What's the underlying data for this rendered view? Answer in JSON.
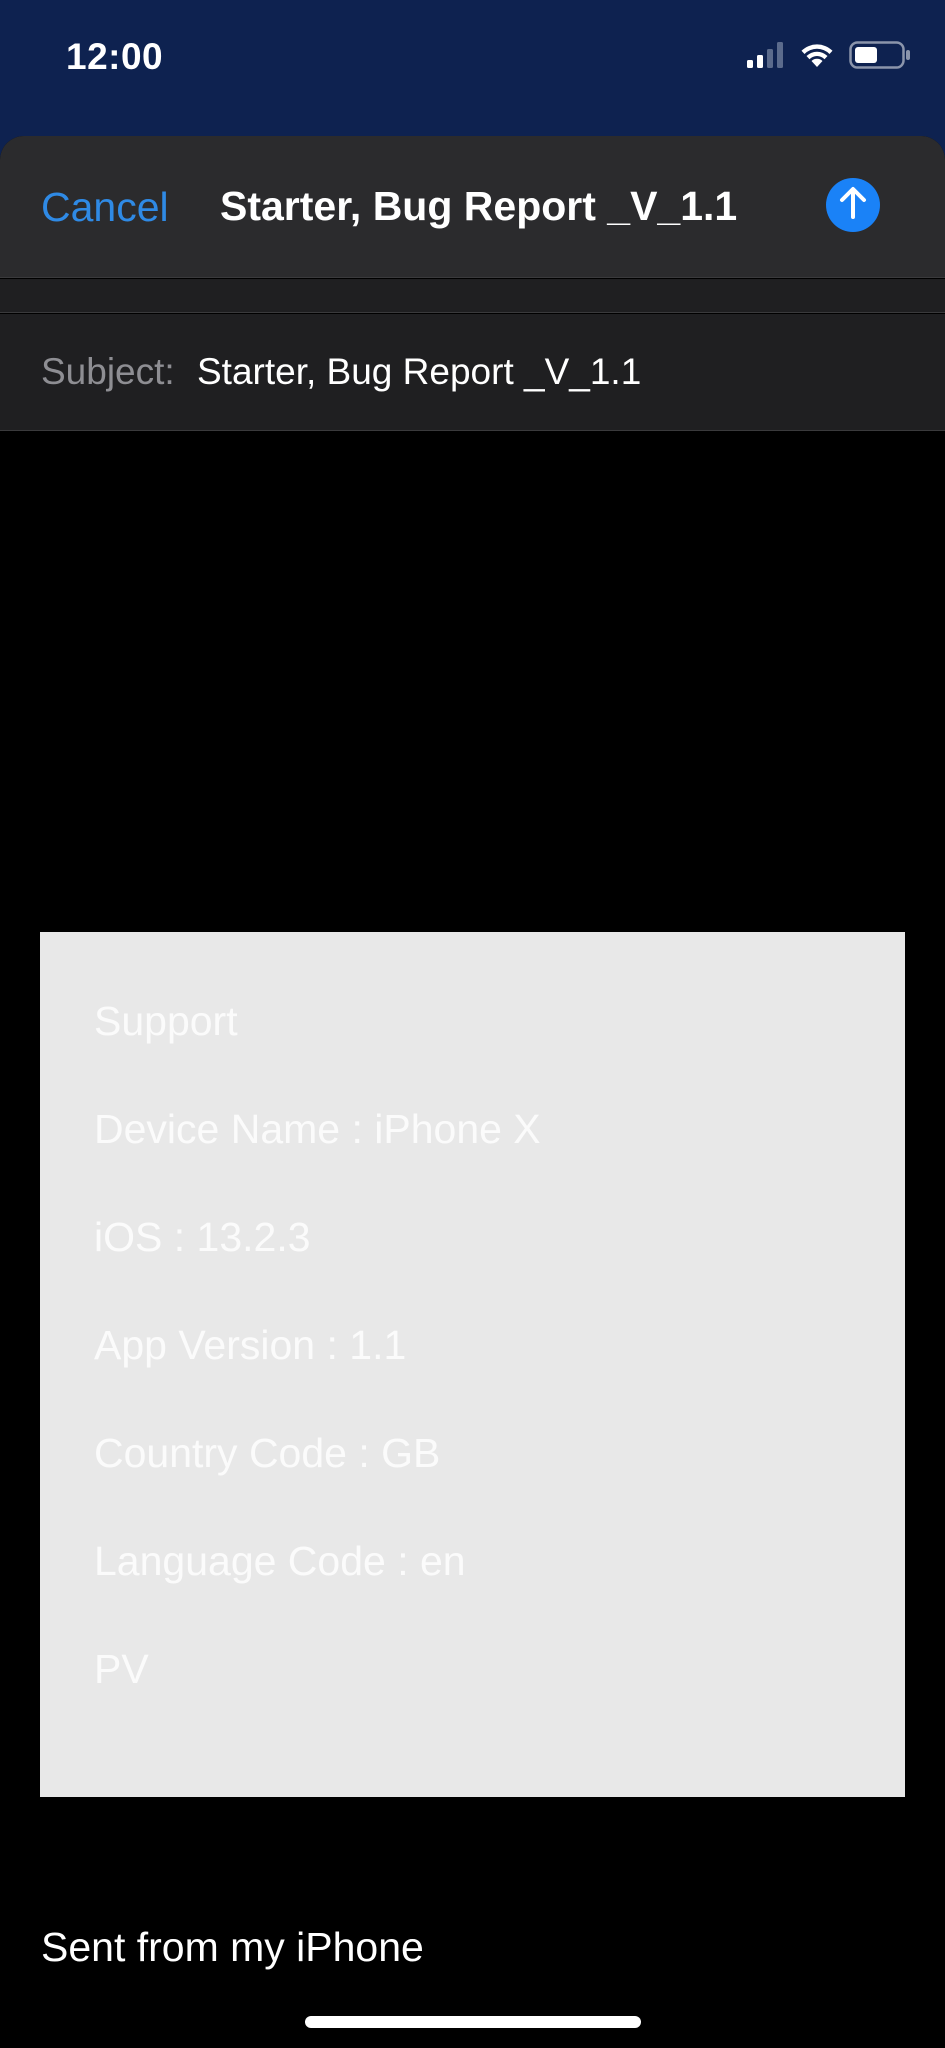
{
  "status_bar": {
    "time": "12:00",
    "icons": [
      "cellular-signal-icon",
      "wifi-icon",
      "battery-icon"
    ]
  },
  "compose": {
    "cancel_label": "Cancel",
    "title": "Starter, Bug Report _V_1.1",
    "send_icon": "arrow-up-icon",
    "subject_label": "Subject:",
    "subject_value": "Starter, Bug Report _V_1.1"
  },
  "body": {
    "info_lines": [
      "Support",
      "Device Name : iPhone X",
      "iOS : 13.2.3",
      "App Version : 1.1",
      "Country Code : GB",
      "Language Code : en",
      "PV"
    ],
    "signature": "Sent from my iPhone"
  },
  "colors": {
    "accent": "#2f8ae5",
    "send_button": "#1a82f7",
    "status_background": "#0e2250",
    "card_background": "#e8e8e8"
  }
}
